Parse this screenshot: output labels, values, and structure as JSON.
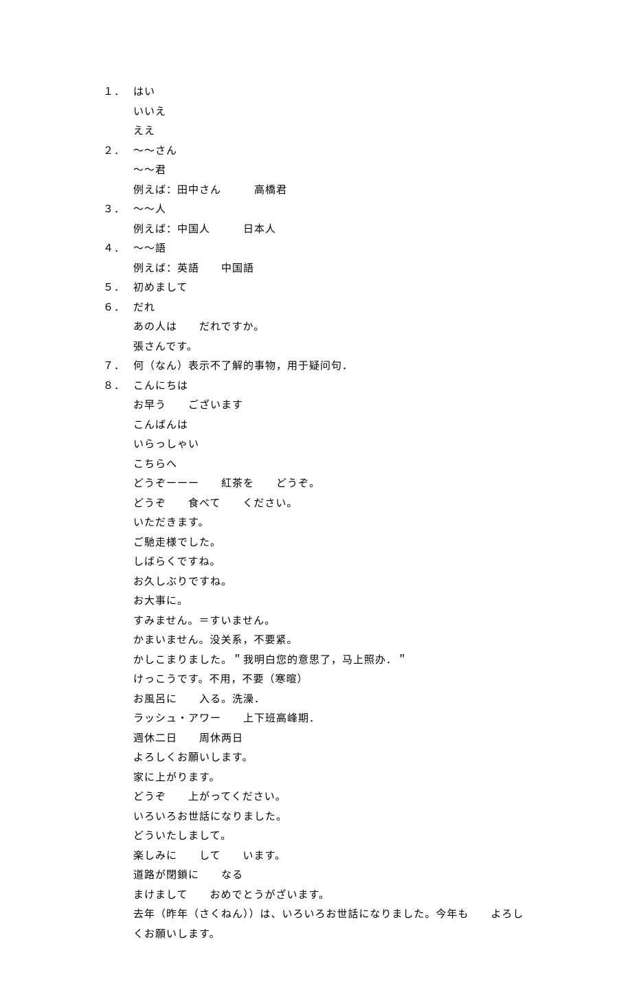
{
  "entries": [
    {
      "num": "１．",
      "head": "はい",
      "subs": [
        "いいえ",
        "ええ"
      ]
    },
    {
      "num": "２．",
      "head": "～～さん",
      "subs": [
        "～～君",
        "例えば：田中さん　　　高橋君"
      ]
    },
    {
      "num": "３．",
      "head": "～～人",
      "subs": [
        "例えば：中国人　　　日本人"
      ]
    },
    {
      "num": "４．",
      "head": "～～語",
      "subs": [
        "例えば：英語　　中国語"
      ]
    },
    {
      "num": "５．",
      "head": "初めまして",
      "subs": []
    },
    {
      "num": "６．",
      "head": "だれ",
      "subs": [
        "あの人は　　だれですか。",
        "張さんです。"
      ]
    },
    {
      "num": "７．",
      "head": "何（なん）表示不了解的事物，用于疑问句．",
      "subs": []
    },
    {
      "num": "８．",
      "head": "こんにちは",
      "subs": [
        "お早う　　ございます",
        "こんばんは",
        "いらっしゃい",
        "こちらへ",
        "どうぞーーー　　紅茶を　　どうぞ。",
        "どうぞ　　食べて　　ください。",
        "いただきます。",
        "ご馳走様でした。",
        "しばらくですね。",
        "お久しぶりですね。",
        "お大事に。",
        "すみません。＝すいません。",
        "かまいません。没关系，不要紧。",
        "かしこまりました。＂我明白您的意思了，马上照办．＂",
        "けっこうです。不用，不要（寒暄）",
        "お風呂に　　入る。洗澡．",
        "ラッシュ・アワー　　上下班高峰期．",
        "週休二日　　周休两日",
        "よろしくお願いします。",
        "家に上がります。",
        "どうぞ　　上がってください。",
        "いろいろお世話になりました。",
        "どういたしまして。",
        "楽しみに　　して　　います。",
        "道路が閉鎖に　　なる",
        "まけまして　　おめでとうがざいます。",
        "去年（昨年（さくねん））は、いろいろお世話になりました。今年も　　よろしくお願いします。"
      ]
    }
  ]
}
